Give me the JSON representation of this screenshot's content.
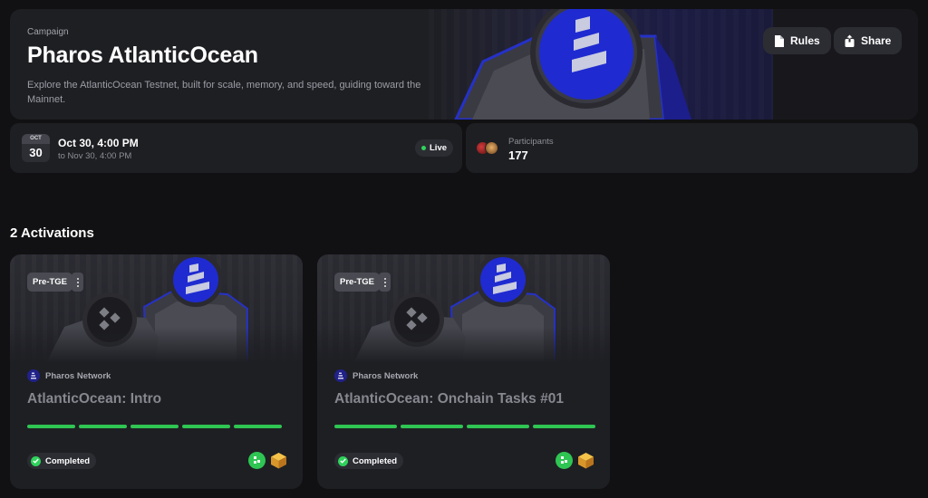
{
  "campaign": {
    "eyebrow": "Campaign",
    "title": "Pharos AtlanticOcean",
    "description": "Explore the AtlanticOcean Testnet, built for scale, memory, and speed, guiding toward the Mainnet.",
    "rules_label": "Rules",
    "share_label": "Share"
  },
  "schedule": {
    "cal_month": "OCT",
    "cal_day": "30",
    "start": "Oct 30, 4:00 PM",
    "end": "to Nov 30, 4:00 PM",
    "status": "Live"
  },
  "participants": {
    "label": "Participants",
    "count": "177"
  },
  "activations": {
    "heading": "2 Activations",
    "items": [
      {
        "badge": "Pre-TGE",
        "org": "Pharos Network",
        "title": "AtlanticOcean: Intro",
        "progress_segments": 5,
        "progress_completed": 5,
        "status": "Completed"
      },
      {
        "badge": "Pre-TGE",
        "org": "Pharos Network",
        "title": "AtlanticOcean: Onchain Tasks #01",
        "progress_segments": 4,
        "progress_completed": 4,
        "status": "Completed"
      }
    ]
  },
  "colors": {
    "background": "#111113",
    "card": "#1e1f23",
    "accent_green": "#2fc553",
    "brand_blue": "#1f2bd0"
  },
  "icons": {
    "rules": "document-icon",
    "share": "share-icon",
    "status_live": "green-dot-icon",
    "completed": "check-circle-icon",
    "reward_1": "green-token-icon",
    "reward_2": "cube-box-icon",
    "more": "kebab-icon"
  }
}
